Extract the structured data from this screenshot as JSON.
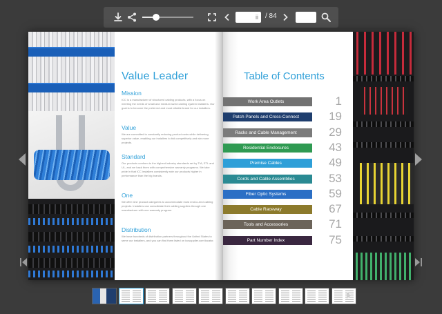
{
  "toolbar": {
    "page_current_placeholder": "ii",
    "page_total": "/ 84",
    "zoom_level": 0.27
  },
  "left_page": {
    "title": "Value Leader",
    "sections": [
      {
        "heading": "Mission",
        "body": "ICC is a manufacturer of structured cabling products, with a focus on meeting the needs of small and medium sized cabling system installers. Our goal is to become the preferred and most reliable brand for our installers."
      },
      {
        "heading": "Value",
        "body": "We are committed to constantly reducing product costs while delivering superior value, enabling our installers to bid competitively and win more projects."
      },
      {
        "heading": "Standard",
        "body": "Our products conform to the highest industry standards set by TIA, ETL and UL, and we back them with comprehensive warranty programs. We take pride in that ICC installers consistently rate our products higher in performance than the big brands."
      },
      {
        "heading": "One",
        "body": "We offer nine product categories to accommodate most end-to-end cabling projects. Installers can consolidate their cabling supplies through one manufacturer with one warranty program."
      },
      {
        "heading": "Distribution",
        "body": "We have hundreds of distribution partners throughout the United States to serve our installers, and you can find them listed on iccsupplier.com/locator."
      }
    ]
  },
  "right_page": {
    "title": "Table of Contents",
    "items": [
      {
        "label": "Work Area Outlets",
        "page": "1",
        "color": "#727272"
      },
      {
        "label": "Patch Panels and Cross-Connect",
        "page": "19",
        "color": "#1f3e6e"
      },
      {
        "label": "Racks and Cable Management",
        "page": "29",
        "color": "#7b7b7b"
      },
      {
        "label": "Residential Enclosures",
        "page": "43",
        "color": "#2f9a52"
      },
      {
        "label": "Premise Cables",
        "page": "49",
        "color": "#2e9fd8"
      },
      {
        "label": "Cords and Cable Assemblies",
        "page": "53",
        "color": "#2a8a93"
      },
      {
        "label": "Fiber Optic Systems",
        "page": "59",
        "color": "#2b6fc5"
      },
      {
        "label": "Cable Raceway",
        "page": "67",
        "color": "#8c7a2c"
      },
      {
        "label": "Tools and Accessories",
        "page": "71",
        "color": "#6c645a"
      },
      {
        "label": "Part Number Index",
        "page": "75",
        "color": "#3a2740"
      }
    ]
  },
  "thumbnails": {
    "count": 10,
    "active_index": 1
  },
  "icons": [
    "download-icon",
    "share-icon",
    "fullscreen-icon",
    "prev-page-icon",
    "next-page-icon",
    "search-icon",
    "first-page-icon",
    "last-page-icon"
  ]
}
